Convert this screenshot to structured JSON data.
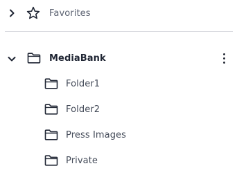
{
  "favorites": {
    "label": "Favorites",
    "chevron_icon": "chevron-right-icon",
    "icon": "star-icon"
  },
  "root": {
    "label": "MediaBank",
    "chevron_icon": "chevron-down-icon",
    "icon": "folder-icon",
    "menu_icon": "more-vertical-icon",
    "children": [
      {
        "label": "Folder1",
        "icon": "folder-icon"
      },
      {
        "label": "Folder2",
        "icon": "folder-icon"
      },
      {
        "label": "Press Images",
        "icon": "folder-icon"
      },
      {
        "label": "Private",
        "icon": "folder-icon"
      }
    ]
  }
}
